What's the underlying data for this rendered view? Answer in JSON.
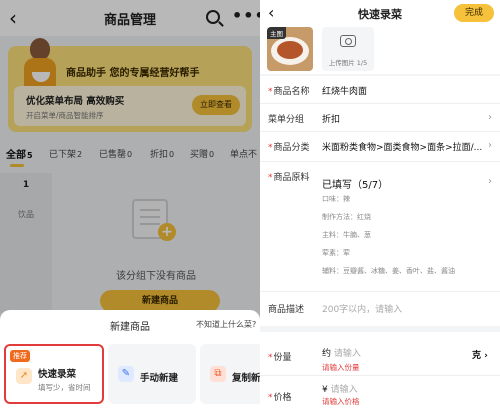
{
  "left": {
    "nav": {
      "title": "商品管理"
    },
    "banner": {
      "headline": "商品助手 您的专属经营好帮手",
      "card_title": "优化菜单布局 高效购买",
      "card_subtitle": "开启菜单/商品智能排序",
      "card_button": "立即查看"
    },
    "tabs": [
      {
        "label": "全部",
        "count": "5"
      },
      {
        "label": "已下架",
        "count": "2"
      },
      {
        "label": "已售罄",
        "count": "0"
      },
      {
        "label": "折扣",
        "count": "0"
      },
      {
        "label": "买赠",
        "count": "0"
      },
      {
        "label": "单点不",
        "count": ""
      }
    ],
    "subcats": {
      "count": "1",
      "item": "饮品"
    },
    "empty": {
      "message": "该分组下没有商品",
      "button": "新建商品"
    },
    "sheet": {
      "title": "新建商品",
      "help": "不知道上什么菜?",
      "options": {
        "quick": {
          "badge": "推荐",
          "label": "快速录菜",
          "sub": "填写少，省时间"
        },
        "manual": {
          "label": "手动新建"
        },
        "copy": {
          "label": "复制新"
        }
      }
    }
  },
  "right": {
    "nav": {
      "title": "快速录菜",
      "done": "完成"
    },
    "images": {
      "main_tag": "主图",
      "upload_label": "上传图片 1/5"
    },
    "form": {
      "name": {
        "label": "商品名称",
        "value": "红烧牛肉面"
      },
      "group": {
        "label": "菜单分组",
        "value": "折扣"
      },
      "category": {
        "label": "商品分类",
        "value": "米面粉类食物>面类食物>面条>拉面/..."
      },
      "ingredients": {
        "label": "商品原料",
        "value": "已填写（5/7）",
        "lines": [
          "口味：辣",
          "制作方法：红烧",
          "主料：牛腩、葱",
          "荤素：荤",
          "辅料：豆瓣酱、冰糖、姜、香叶、盐、酱油"
        ]
      },
      "description": {
        "label": "商品描述",
        "placeholder": "200字以内，请输入"
      },
      "portion": {
        "label": "份量",
        "prefix": "约",
        "placeholder": "请输入",
        "error": "请输入份量",
        "unit": "克"
      },
      "price": {
        "label": "价格",
        "prefix": "¥",
        "placeholder": "请输入",
        "error": "请输入价格"
      }
    }
  },
  "colors": {
    "accent": "#f6c13b",
    "banner": "#fbe07a",
    "error": "#e23b3b",
    "badge": "#f06a1d"
  }
}
